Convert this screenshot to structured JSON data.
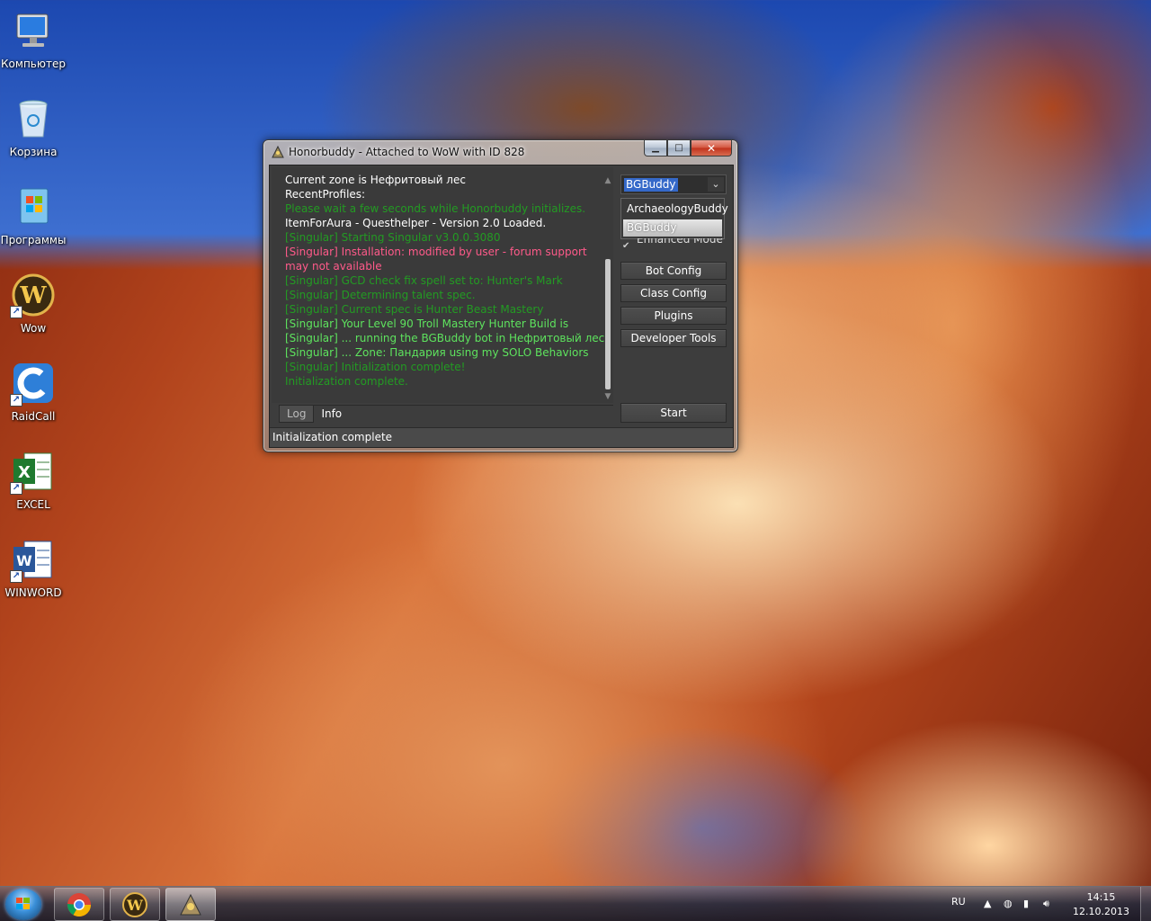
{
  "desktop": {
    "icons": [
      {
        "label": "Компьютер"
      },
      {
        "label": "Корзина"
      },
      {
        "label": "Программы"
      },
      {
        "label": "Wow"
      },
      {
        "label": "RaidCall"
      },
      {
        "label": "EXCEL"
      },
      {
        "label": "WINWORD"
      }
    ]
  },
  "window": {
    "title": "Honorbuddy - Attached to WoW with ID 828",
    "buttons": {
      "minimize": "▁",
      "maximize": "□",
      "close": "✕"
    },
    "log": [
      {
        "text": "Current zone is Нефритовый лес",
        "color": "#ffffff"
      },
      {
        "text": "RecentProfiles:",
        "color": "#ffffff"
      },
      {
        "text": "Please wait a few seconds while Honorbuddy initializes.",
        "color": "#239b23"
      },
      {
        "text": "ItemForAura - Questhelper - Version 2.0 Loaded.",
        "color": "#ffffff"
      },
      {
        "text": "[Singular] Starting Singular v3.0.0.3080",
        "color": "#239b23"
      },
      {
        "text": "[Singular] Installation: modified by user - forum support may not available",
        "color": "#ff5a8a"
      },
      {
        "text": "[Singular] GCD check fix spell set to: Hunter's Mark",
        "color": "#239b23"
      },
      {
        "text": "[Singular] Determining talent spec.",
        "color": "#239b23"
      },
      {
        "text": "[Singular] Current spec is  Hunter Beast Mastery",
        "color": "#239b23"
      },
      {
        "text": "[Singular] Your Level 90 Troll Mastery Hunter Build is",
        "color": "#5ee35e"
      },
      {
        "text": "[Singular] ... running the BGBuddy bot in Нефритовый лес",
        "color": "#5ee35e"
      },
      {
        "text": "[Singular] ... Zone: Пандария using my SOLO Behaviors",
        "color": "#5ee35e"
      },
      {
        "text": "[Singular] Initialization complete!",
        "color": "#239b23"
      },
      {
        "text": "Initialization complete.",
        "color": "#239b23"
      }
    ],
    "tabs": [
      {
        "label": "Log"
      },
      {
        "label": "Info"
      }
    ],
    "status": "Initialization complete",
    "bot_select": {
      "value": "BGBuddy",
      "options": [
        "ArchaeologyBuddy",
        "BGBuddy"
      ]
    },
    "checkbox_label": "Enhanced Mode",
    "side_buttons": {
      "bot_config": "Bot Config",
      "class_config": "Class Config",
      "plugins": "Plugins",
      "developer_tools": "Developer Tools",
      "start": "Start"
    }
  },
  "taskbar": {
    "language": "RU",
    "time": "14:15",
    "date": "12.10.2013"
  }
}
